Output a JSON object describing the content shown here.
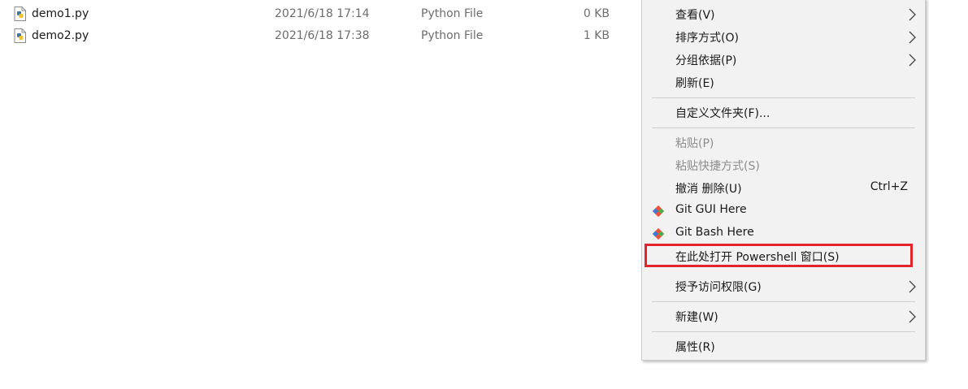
{
  "files": [
    {
      "name": "demo1.py",
      "modified": "2021/6/18 17:14",
      "type": "Python File",
      "size": "0 KB",
      "icon": "python-file-icon"
    },
    {
      "name": "demo2.py",
      "modified": "2021/6/18 17:38",
      "type": "Python File",
      "size": "1 KB",
      "icon": "python-file-icon"
    }
  ],
  "menu": {
    "view": {
      "label": "查看(V)"
    },
    "sort_by": {
      "label": "排序方式(O)"
    },
    "group_by": {
      "label": "分组依据(P)"
    },
    "refresh": {
      "label": "刷新(E)"
    },
    "customize": {
      "label": "自定义文件夹(F)..."
    },
    "paste": {
      "label": "粘贴(P)",
      "disabled": true
    },
    "paste_shortcut": {
      "label": "粘贴快捷方式(S)",
      "disabled": true
    },
    "undo_delete": {
      "label": "撤消 删除(U)",
      "shortcut": "Ctrl+Z"
    },
    "git_gui": {
      "label": "Git GUI Here",
      "icon": "git-icon"
    },
    "git_bash": {
      "label": "Git Bash Here",
      "icon": "git-icon"
    },
    "open_powershell": {
      "label": "在此处打开 Powershell 窗口(S)",
      "highlighted": true
    },
    "give_access": {
      "label": "授予访问权限(G)"
    },
    "new": {
      "label": "新建(W)"
    },
    "properties": {
      "label": "属性(R)"
    }
  },
  "colors": {
    "highlight_border": "#e3242b",
    "menu_background": "#f2f2f2",
    "git_orange": "#f05033",
    "git_green": "#4cae4f",
    "git_blue": "#3e7bd6"
  }
}
